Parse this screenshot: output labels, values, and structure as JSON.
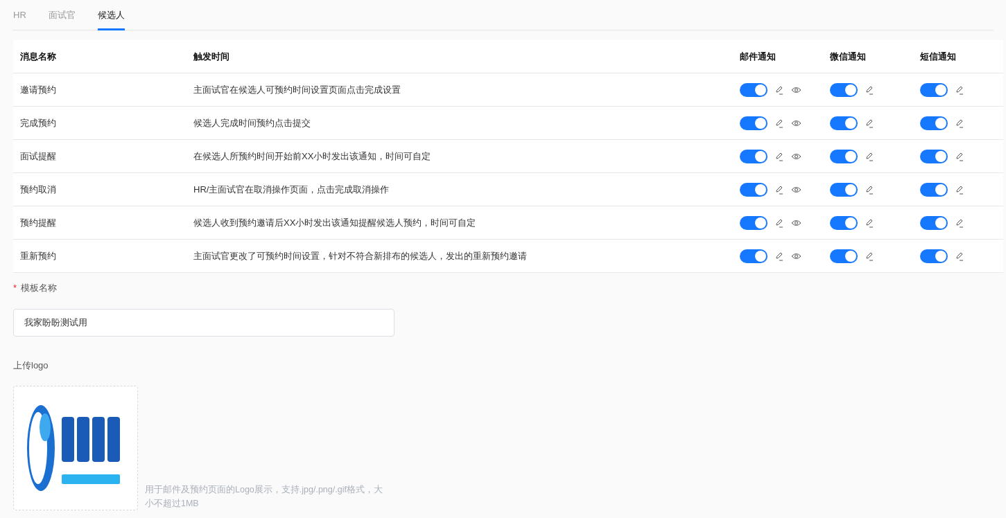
{
  "tabs": [
    {
      "label": "HR",
      "selected": false
    },
    {
      "label": "面试官",
      "selected": false
    },
    {
      "label": "候选人",
      "selected": true
    }
  ],
  "table": {
    "columns": [
      "消息名称",
      "触发时间",
      "邮件通知",
      "微信通知",
      "短信通知"
    ],
    "rows": [
      {
        "name": "邀请预约",
        "trigger": "主面试官在候选人可预约时间设置页面点击完成设置",
        "channels": [
          {
            "kind": "email",
            "on": true
          },
          {
            "kind": "wechat",
            "on": true
          },
          {
            "kind": "sms",
            "on": true
          }
        ]
      },
      {
        "name": "完成预约",
        "trigger": "候选人完成时间预约点击提交",
        "channels": [
          {
            "kind": "email",
            "on": true
          },
          {
            "kind": "wechat",
            "on": true
          },
          {
            "kind": "sms",
            "on": true
          }
        ]
      },
      {
        "name": "面试提醒",
        "trigger": "在候选人所预约时间开始前XX小时发出该通知，时间可自定",
        "channels": [
          {
            "kind": "email",
            "on": true
          },
          {
            "kind": "wechat",
            "on": true
          },
          {
            "kind": "sms",
            "on": true
          }
        ]
      },
      {
        "name": "预约取消",
        "trigger": "HR/主面试官在取消操作页面，点击完成取消操作",
        "channels": [
          {
            "kind": "email",
            "on": true
          },
          {
            "kind": "wechat",
            "on": true
          },
          {
            "kind": "sms",
            "on": true
          }
        ]
      },
      {
        "name": "预约提醒",
        "trigger": "候选人收到预约邀请后XX小时发出该通知提醒候选人预约，时间可自定",
        "channels": [
          {
            "kind": "email",
            "on": true
          },
          {
            "kind": "wechat",
            "on": true
          },
          {
            "kind": "sms",
            "on": true
          }
        ]
      },
      {
        "name": "重新预约",
        "trigger": "主面试官更改了可预约时间设置，针对不符合新排布的候选人，发出的重新预约邀请",
        "channels": [
          {
            "kind": "email",
            "on": true
          },
          {
            "kind": "wechat",
            "on": true
          },
          {
            "kind": "sms",
            "on": true
          }
        ]
      }
    ]
  },
  "template_name": {
    "required_mark": "*",
    "label": "模板名称",
    "value": "我家盼盼测试用"
  },
  "logo_upload": {
    "label": "上传logo",
    "hint": "用于邮件及预约页面的Logo展示，支持.jpg/.png/.gif格式，大小不超过1MB"
  }
}
